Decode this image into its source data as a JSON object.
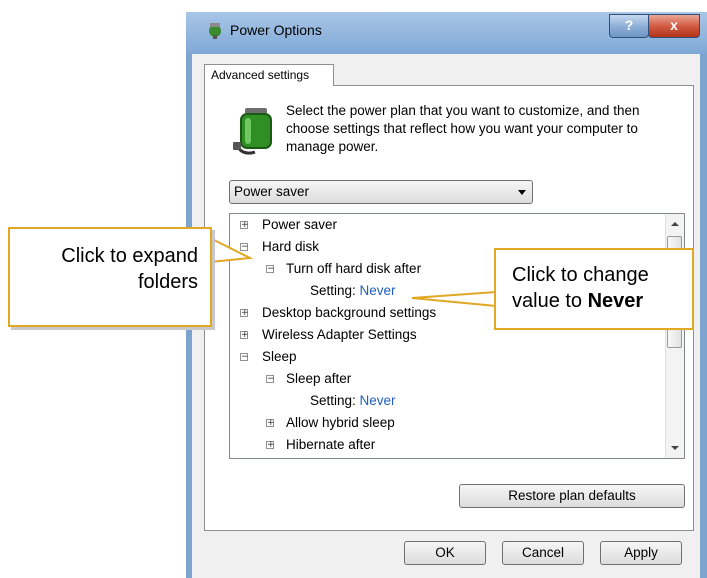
{
  "window": {
    "title": "Power Options",
    "help_label": "?",
    "close_label": "x"
  },
  "tab": {
    "label": "Advanced settings"
  },
  "description": "Select the power plan that you want to customize, and then choose settings that reflect how you want your computer to manage power.",
  "plan_select": {
    "value": "Power saver"
  },
  "tree": {
    "power_saver": "Power saver",
    "hard_disk": "Hard disk",
    "turn_off_hard_disk": "Turn off hard disk after",
    "setting_label": "Setting:",
    "hard_disk_setting_value": "Never",
    "desktop_background": "Desktop background settings",
    "wireless_adapter": "Wireless Adapter Settings",
    "sleep": "Sleep",
    "sleep_after": "Sleep after",
    "sleep_after_setting_value": "Never",
    "allow_hybrid_sleep": "Allow hybrid sleep",
    "hibernate_after": "Hibernate after"
  },
  "buttons": {
    "restore": "Restore plan defaults",
    "ok": "OK",
    "cancel": "Cancel",
    "apply": "Apply"
  },
  "callouts": {
    "left_line1": "Click to expand",
    "left_line2": "folders",
    "right_line1": "Click to change",
    "right_line2_prefix": "value to ",
    "right_line2_bold": "Never"
  },
  "colors": {
    "callout_border": "#e0a825",
    "link_value": "#1f5fbf",
    "window_frame": "#7da3cf"
  },
  "icons": {
    "app": "power-options-icon",
    "plan": "battery-plug-icon",
    "expand": "plus-box-icon",
    "collapse": "minus-box-icon"
  }
}
